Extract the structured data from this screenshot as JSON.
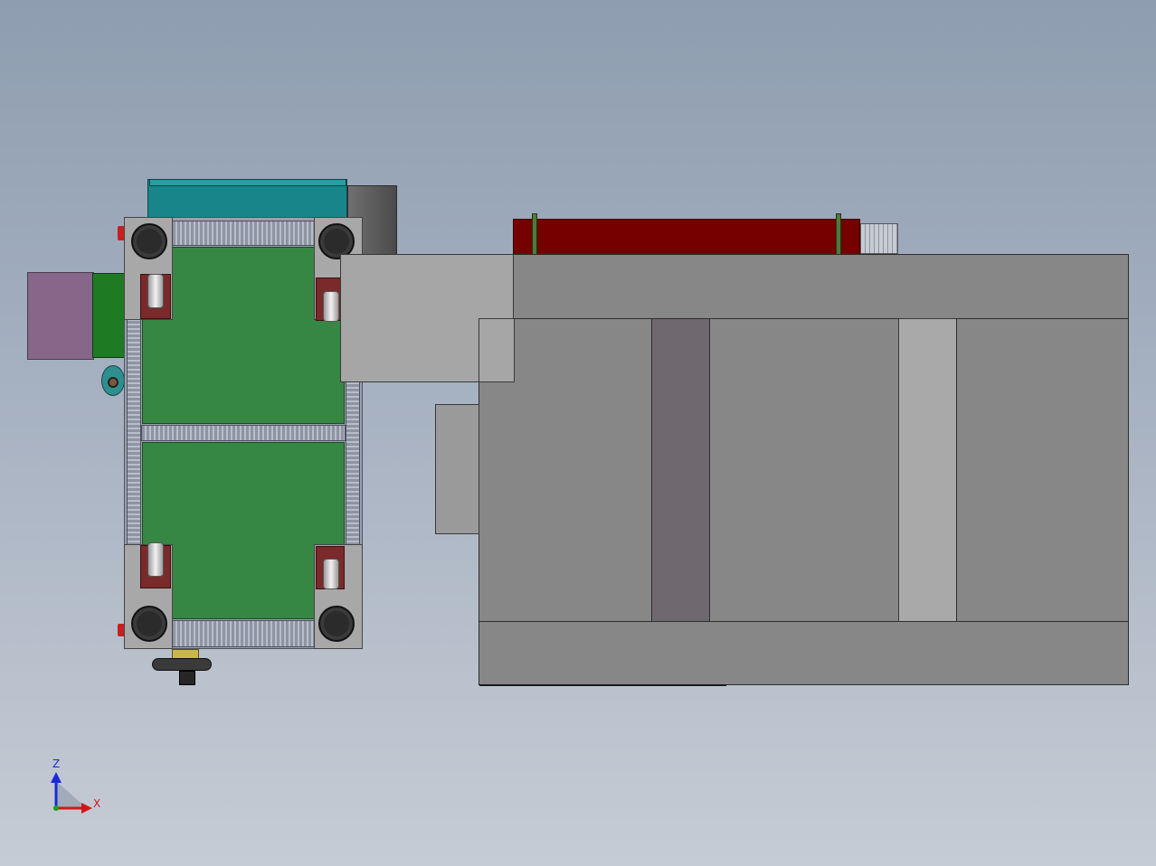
{
  "viewport": {
    "background_top": "#8e9db0",
    "background_bottom": "#c6ccd5"
  },
  "triad": {
    "z_label": "Z",
    "x_label": "X",
    "z_color": "#1a2bd6",
    "x_color": "#d01818",
    "origin_color": "#1aa01a"
  },
  "colors": {
    "panel_green": "#368743",
    "frame_gray": "#9aa1ad",
    "cover_teal": "#17858a",
    "motor_purple": "#86678a",
    "bar_dark_red": "#750000",
    "body_gray": "#878787"
  }
}
